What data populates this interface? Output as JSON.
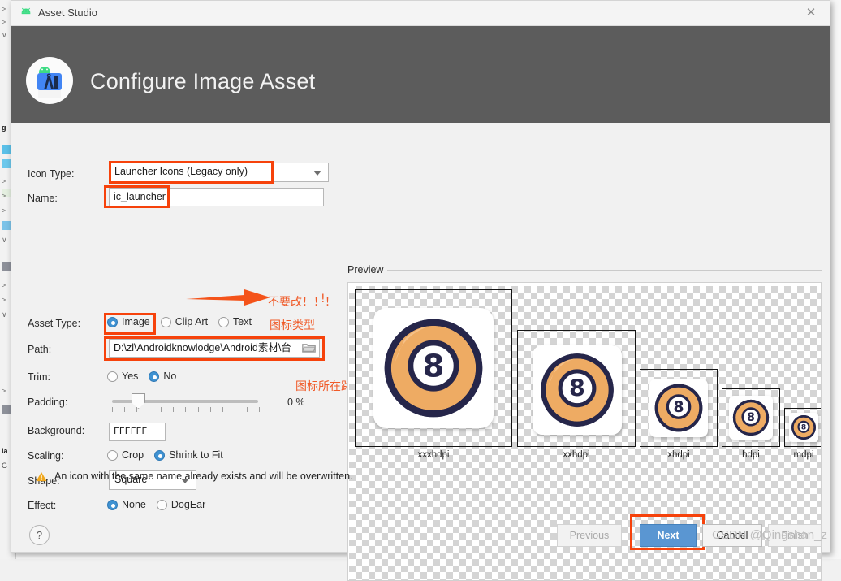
{
  "window": {
    "title": "Asset Studio",
    "titlebar_icon": "android-bug-icon",
    "close_label": "✕"
  },
  "header": {
    "title": "Configure Image Asset",
    "icon": "android-studio-icon",
    "background_color": "#5c5c5c"
  },
  "form": {
    "icon_type": {
      "label": "Icon Type:",
      "value": "Launcher Icons (Legacy only)",
      "highlighted": true
    },
    "name": {
      "label": "Name:",
      "value": "ic_launcher",
      "highlighted": true
    },
    "asset_type": {
      "label": "Asset Type:",
      "options": [
        "Image",
        "Clip Art",
        "Text"
      ],
      "selected": "Image",
      "highlighted": true
    },
    "path": {
      "label": "Path:",
      "value": "D:\\zl\\Androidknowlodge\\Android素材\\台",
      "browse_icon": "folder-icon",
      "highlighted": true
    },
    "trim": {
      "label": "Trim:",
      "options": [
        "Yes",
        "No"
      ],
      "selected": "No"
    },
    "padding": {
      "label": "Padding:",
      "value": "0 %",
      "slider_percent": 13
    },
    "background": {
      "label": "Background:",
      "value": "FFFFFF"
    },
    "scaling": {
      "label": "Scaling:",
      "options": [
        "Crop",
        "Shrink to Fit"
      ],
      "selected": "Shrink to Fit"
    },
    "shape": {
      "label": "Shape:",
      "value": "Square"
    },
    "effect": {
      "label": "Effect:",
      "options": [
        "None",
        "DogEar"
      ],
      "selected": "None"
    }
  },
  "annotations": {
    "highlight_color": "#f6420b",
    "note_color": "#f05a28",
    "name_note": "不要改！！！",
    "asset_type_note": "图标类型",
    "path_note": "图标所在路径",
    "arrow_icon": "right-arrow-annotation"
  },
  "preview": {
    "label": "Preview",
    "densities": [
      {
        "label": "xxxhdpi",
        "frame_size": 192
      },
      {
        "label": "xxhdpi",
        "frame_size": 144
      },
      {
        "label": "xhdpi",
        "frame_size": 96
      },
      {
        "label": "hdpi",
        "frame_size": 72
      },
      {
        "label": "mdpi",
        "frame_size": 48
      }
    ],
    "icon_description": "orange-eight-ball-icon",
    "icon_colors": {
      "ball_light": "#eeab63",
      "ball_mid": "#e59a4e",
      "ball_shadow": "#d98b3c",
      "outline": "#26264a",
      "number_circle": "#ffffff"
    }
  },
  "warning": {
    "icon": "warning-triangle-icon",
    "text": "An icon with the same name already exists and will be overwritten."
  },
  "footer": {
    "help_label": "?",
    "previous_label": "Previous",
    "previous_enabled": false,
    "next_label": "Next",
    "next_highlighted": true,
    "cancel_label": "Cancel",
    "finish_label": "Finish",
    "finish_enabled": false
  },
  "watermark": "CSDN @Qingshan_z",
  "ide_background": {
    "visible_chars": [
      "g",
      "la",
      "G"
    ]
  }
}
